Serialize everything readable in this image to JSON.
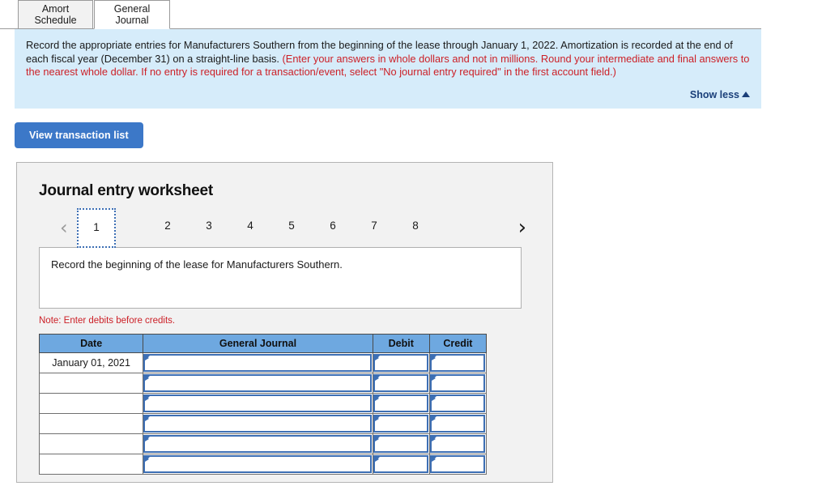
{
  "tabs": [
    {
      "line1": "Amort",
      "line2": "Schedule",
      "active": false
    },
    {
      "line1": "General",
      "line2": "Journal",
      "active": true
    }
  ],
  "banner": {
    "black_text": "Record the appropriate entries for Manufacturers Southern from the beginning of the lease through January 1, 2022. Amortization is recorded at the end of each fiscal year (December 31) on a straight-line basis. ",
    "red_text": "(Enter your answers in whole dollars and not in millions. Round your intermediate and final answers to the nearest whole dollar. If no entry is required for a transaction/event, select \"No journal entry required\" in the first account field.)",
    "show_less_label": "Show less",
    "background_color": "#d6ecfa",
    "red_color": "#cc2027",
    "link_color": "#1a3f79"
  },
  "toolbar": {
    "view_transaction_list_label": "View transaction list",
    "button_color": "#3c78c8"
  },
  "worksheet": {
    "title": "Journal entry worksheet",
    "pager": {
      "prev_label": "‹",
      "next_label": "›",
      "pages": [
        "1",
        "2",
        "3",
        "4",
        "5",
        "6",
        "7",
        "8"
      ],
      "selected_page": "1",
      "selected_border_color": "#3d6fb4"
    },
    "description": "Record the beginning of the lease for Manufacturers Southern.",
    "note": "Note: Enter debits before credits.",
    "table": {
      "header_color": "#6ea8e0",
      "columns": [
        "Date",
        "General Journal",
        "Debit",
        "Credit"
      ],
      "rows": [
        {
          "date": "January 01, 2021",
          "general_journal": "",
          "debit": "",
          "credit": ""
        },
        {
          "date": "",
          "general_journal": "",
          "debit": "",
          "credit": ""
        },
        {
          "date": "",
          "general_journal": "",
          "debit": "",
          "credit": ""
        },
        {
          "date": "",
          "general_journal": "",
          "debit": "",
          "credit": ""
        },
        {
          "date": "",
          "general_journal": "",
          "debit": "",
          "credit": ""
        },
        {
          "date": "",
          "general_journal": "",
          "debit": "",
          "credit": ""
        }
      ]
    }
  }
}
